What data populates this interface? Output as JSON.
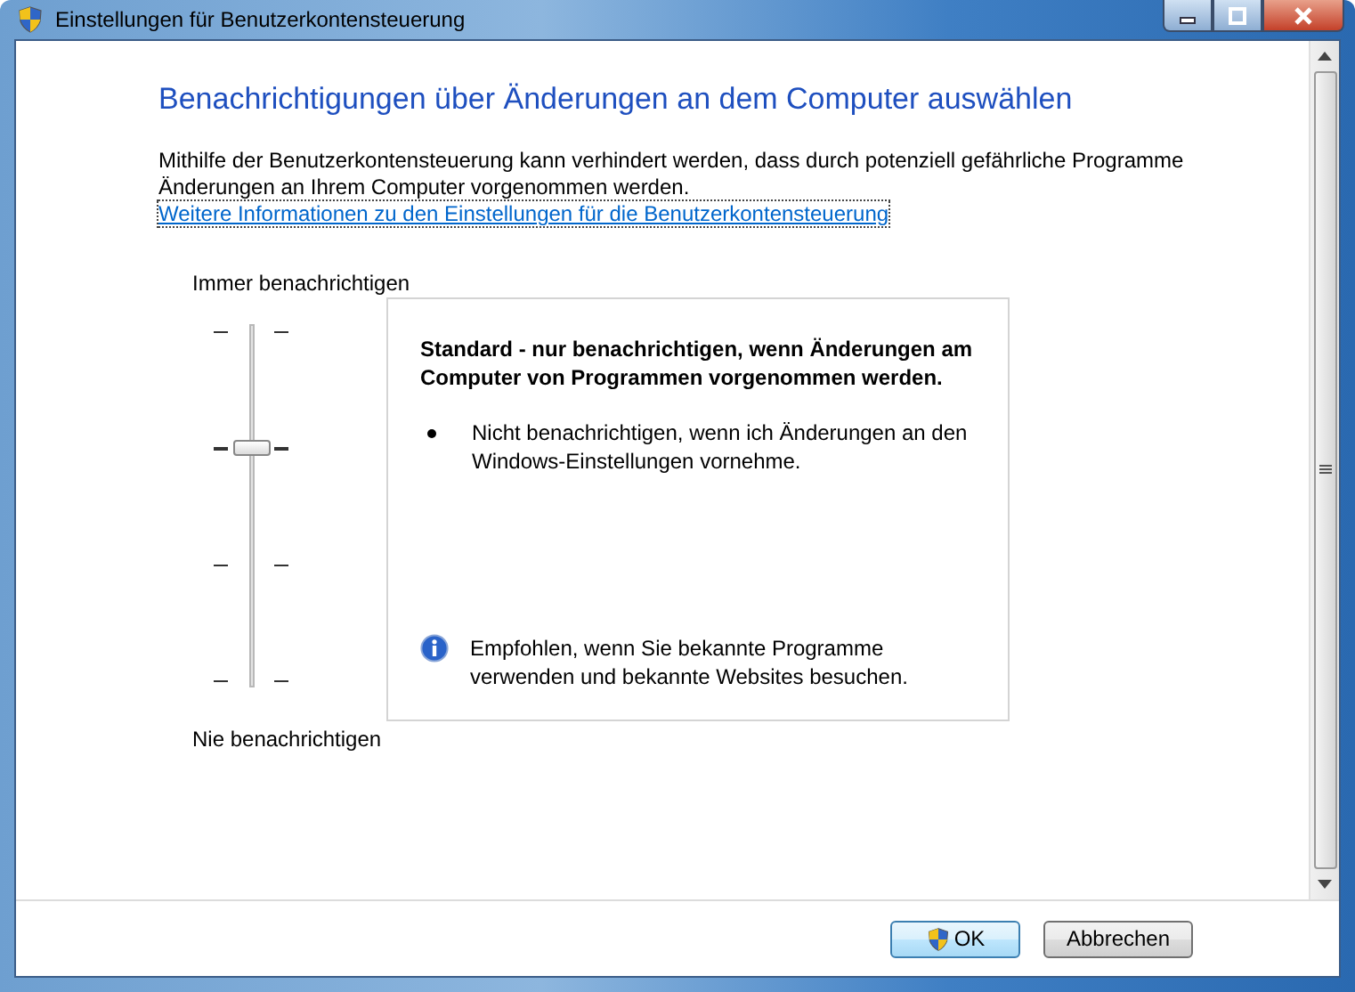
{
  "window": {
    "title": "Einstellungen für Benutzerkontensteuerung"
  },
  "heading": "Benachrichtigungen über Änderungen an dem Computer auswählen",
  "description": "Mithilfe der Benutzerkontensteuerung kann verhindert werden, dass durch potenziell gefährliche Programme Änderungen an Ihrem Computer vorgenommen werden.",
  "link": "Weitere Informationen zu den Einstellungen für die Benutzerkontensteuerung",
  "slider": {
    "top_label": "Immer benachrichtigen",
    "bottom_label": "Nie benachrichtigen",
    "level": 0.667
  },
  "panel": {
    "title": "Standard - nur benachrichtigen, wenn Änderungen am Computer von Programmen vorgenommen werden.",
    "bullets": [
      "Nicht benachrichtigen, wenn ich Änderungen an den Windows-Einstellungen vornehme."
    ],
    "note": "Empfohlen, wenn Sie bekannte Programme verwenden und bekannte Websites besuchen."
  },
  "buttons": [
    {
      "label": "OK",
      "kind": "shield",
      "default": true
    },
    {
      "label": "Abbrechen",
      "kind": "plain",
      "default": false
    }
  ]
}
